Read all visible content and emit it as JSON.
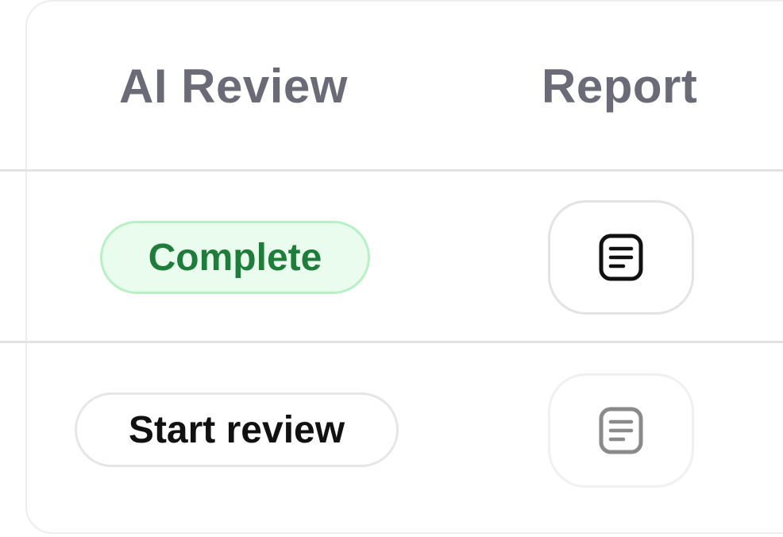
{
  "table": {
    "headers": {
      "ai_review": "AI Review",
      "report": "Report"
    },
    "rows": [
      {
        "ai_review_status": "Complete",
        "report_icon": "document-icon",
        "report_enabled": true
      },
      {
        "ai_review_action": "Start review",
        "report_icon": "document-icon",
        "report_enabled": false
      }
    ]
  },
  "colors": {
    "header_text": "#6b6b78",
    "complete_bg": "#eafcee",
    "complete_border": "#b8f0c6",
    "complete_text": "#1e7d3b",
    "divider": "#e3e3e3"
  }
}
